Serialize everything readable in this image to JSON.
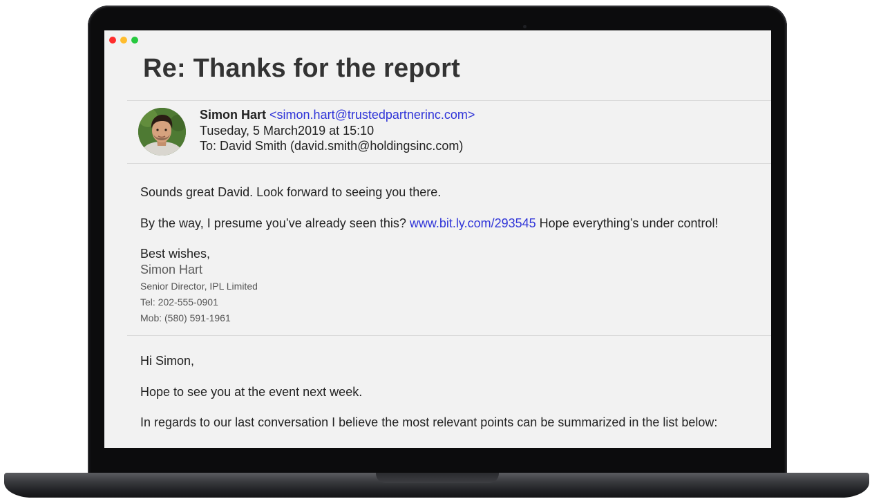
{
  "window": {
    "controls": [
      "close",
      "minimize",
      "maximize"
    ]
  },
  "email": {
    "subject": "Re: Thanks for the report",
    "sender_name": "Simon Hart",
    "sender_email": "<simon.hart@trustedpartnerinc.com>",
    "date": "Tuseday, 5 March2019 at 15:10",
    "to": "To: David Smith (david.smith@holdingsinc.com)",
    "reply": {
      "line1": "Sounds great David. Look forward to seeing you there.",
      "line2_before": "By the way, I presume you’ve already seen this?",
      "line2_link": "www.bit.ly.com/293545",
      "line2_after": "Hope everything’s under control!",
      "closing": "Best wishes,",
      "signature": {
        "name": "Simon Hart",
        "title": "Senior Director, IPL Limited",
        "tel": "Tel: 202-555-0901",
        "mob": "Mob: (580) 591-1961"
      }
    },
    "quoted": {
      "greeting": "Hi Simon,",
      "line1": "Hope to see you at the event next week.",
      "line2": "In regards to our last conversation I believe the most relevant points can be summarized in the list below:"
    }
  },
  "colors": {
    "link": "#2f34d8",
    "close": "#ff2d2d",
    "minimize": "#ffbd2e",
    "maximize": "#27c93f"
  }
}
